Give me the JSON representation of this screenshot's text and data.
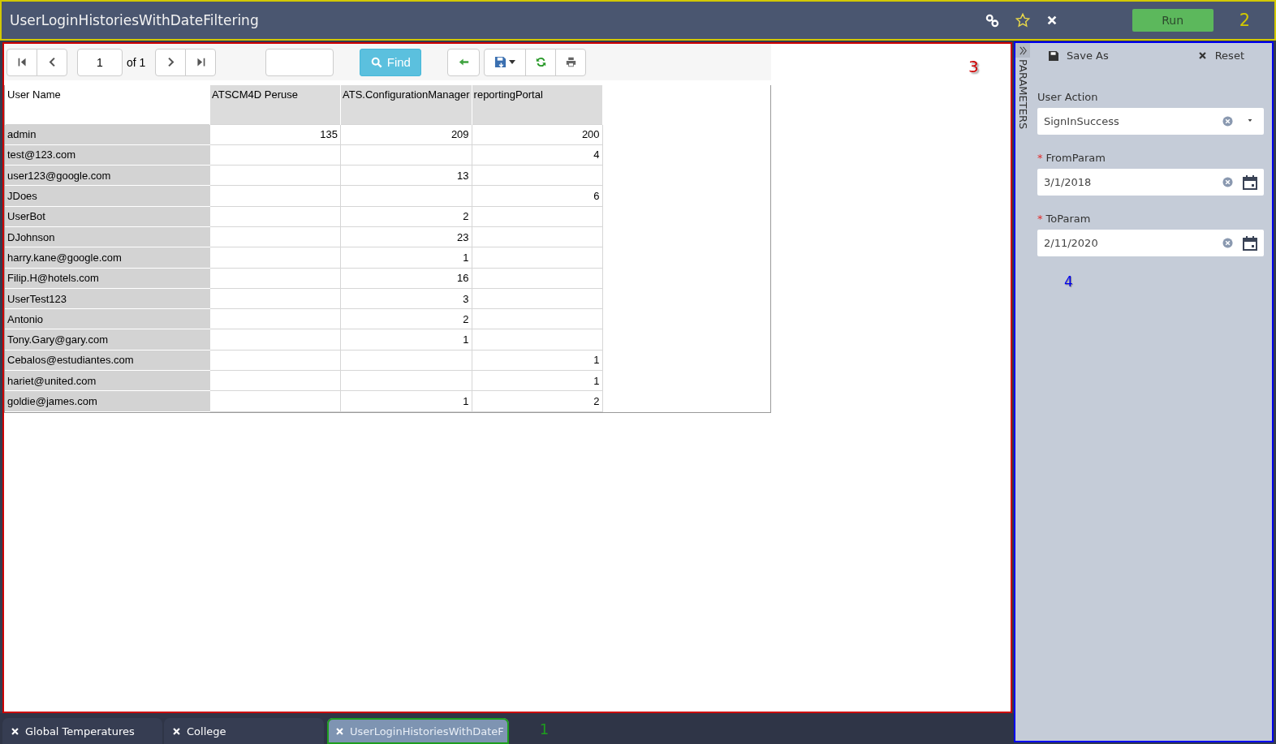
{
  "window": {
    "title": "UserLoginHistoriesWithDateFiltering"
  },
  "header": {
    "run_button": "Run"
  },
  "annotations": [
    {
      "label": "1",
      "color": "#1e9e1e"
    },
    {
      "label": "2",
      "color": "#d2c800"
    },
    {
      "label": "3",
      "color": "#cc0000"
    },
    {
      "label": "4",
      "color": "#0000ee"
    }
  ],
  "toolbar": {
    "page": "1",
    "page_count": "of 1",
    "find_button": "Find"
  },
  "table": {
    "columns": [
      "User Name",
      "ATSCM4D Peruse",
      "ATS.ConfigurationManager",
      "reportingPortal"
    ],
    "rows": [
      {
        "name": "admin",
        "cells": {
          "atscm4d_peruse": "135",
          "ats_configuration_manager": "209",
          "reporting_portal": "200"
        }
      },
      {
        "name": "test@123.com",
        "cells": {
          "reporting_portal": "4"
        }
      },
      {
        "name": "user123@google.com",
        "cells": {
          "ats_configuration_manager": "13"
        }
      },
      {
        "name": "JDoes",
        "cells": {
          "reporting_portal": "6"
        }
      },
      {
        "name": "UserBot",
        "cells": {
          "ats_configuration_manager": "2"
        }
      },
      {
        "name": "DJohnson",
        "cells": {
          "ats_configuration_manager": "23"
        }
      },
      {
        "name": "harry.kane@google.com",
        "cells": {
          "ats_configuration_manager": "1"
        }
      },
      {
        "name": "Filip.H@hotels.com",
        "cells": {
          "ats_configuration_manager": "16"
        }
      },
      {
        "name": "UserTest123",
        "cells": {
          "ats_configuration_manager": "3"
        }
      },
      {
        "name": "Antonio",
        "cells": {
          "ats_configuration_manager": "2"
        }
      },
      {
        "name": "Tony.Gary@gary.com",
        "cells": {
          "ats_configuration_manager": "1"
        }
      },
      {
        "name": "Cebalos@estudiantes.com",
        "cells": {
          "reporting_portal": "1"
        }
      },
      {
        "name": "hariet@united.com",
        "cells": {
          "reporting_portal": "1"
        }
      },
      {
        "name": "goldie@james.com",
        "cells": {
          "ats_configuration_manager": "1",
          "reporting_portal": "2"
        }
      }
    ]
  },
  "parameters": {
    "tab_label": "PARAMETERS",
    "save_as": "Save As",
    "reset": "Reset",
    "fields": [
      {
        "kind": "dropdown",
        "label": "User Action",
        "value": "SignInSuccess"
      },
      {
        "kind": "date",
        "required_mark": "*",
        "label": "FromParam",
        "value": "3/1/2018"
      },
      {
        "kind": "date",
        "required_mark": "*",
        "label": "ToParam",
        "value": "2/11/2020"
      }
    ]
  },
  "doc_tabs": [
    {
      "label": "Global Temperatures",
      "selected": false
    },
    {
      "label": "College",
      "selected": false
    },
    {
      "label": "UserLoginHistoriesWithDateF",
      "selected": true
    }
  ]
}
